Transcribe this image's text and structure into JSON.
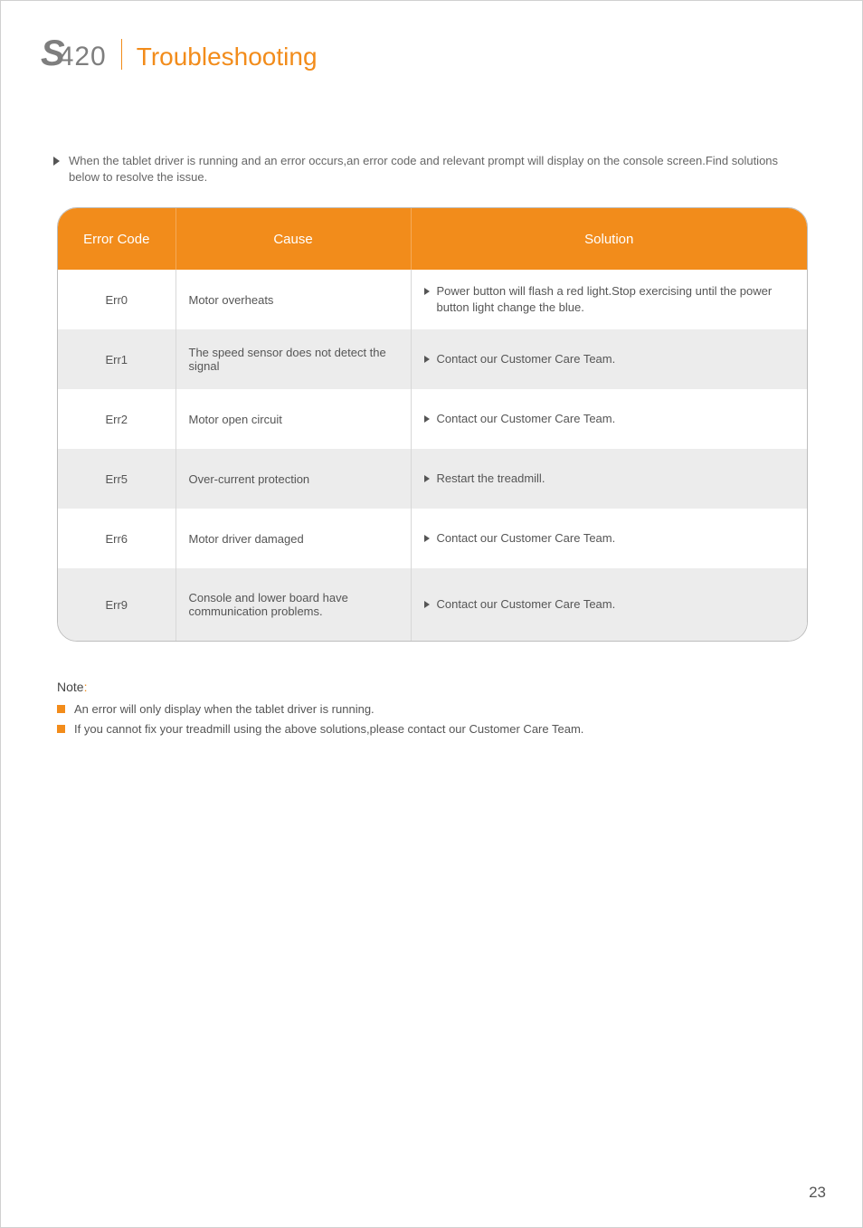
{
  "header": {
    "model_prefix": "S",
    "model_number": "420",
    "section": "Troubleshooting"
  },
  "intro": "When the tablet driver is running and an error occurs,an error code and relevant prompt will display on the console screen.Find solutions below to resolve the issue.",
  "table": {
    "headers": [
      "Error Code",
      "Cause",
      "Solution"
    ],
    "rows": [
      {
        "code": "Err0",
        "cause": "Motor overheats",
        "solution": "Power button will flash a red light.Stop exercising until the power button light change the blue."
      },
      {
        "code": "Err1",
        "cause": "The speed sensor does not detect the signal",
        "solution": "Contact our Customer Care Team."
      },
      {
        "code": "Err2",
        "cause": "Motor open circuit",
        "solution": "Contact our Customer Care Team."
      },
      {
        "code": "Err5",
        "cause": "Over-current protection",
        "solution": "Restart the treadmill."
      },
      {
        "code": "Err6",
        "cause": "Motor driver damaged",
        "solution": "Contact our Customer Care Team."
      },
      {
        "code": "Err9",
        "cause": "Console and lower board have communication problems.",
        "solution": "Contact our Customer Care Team."
      }
    ]
  },
  "notes": {
    "header_text": "Note",
    "header_colon": ":",
    "lines": [
      "An error will only display when the tablet driver is running.",
      "If you cannot fix your treadmill using the above solutions,please contact our Customer Care Team."
    ]
  },
  "page_number": "23"
}
